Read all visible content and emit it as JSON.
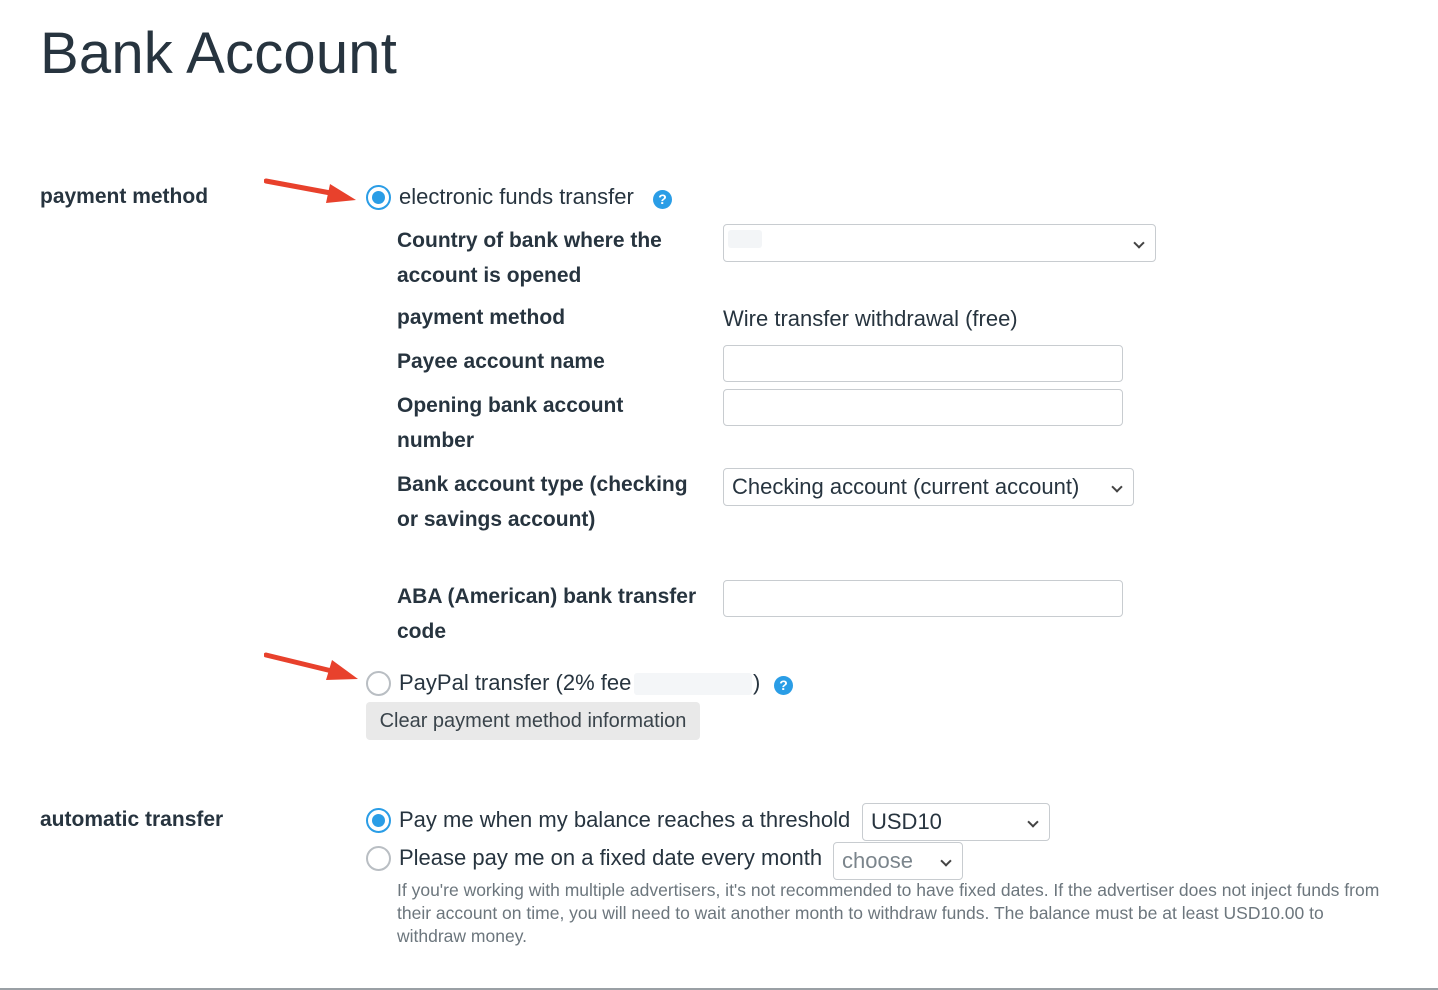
{
  "page": {
    "title": "Bank Account"
  },
  "payment_section": {
    "label": "payment method",
    "eft": {
      "label": "electronic funds transfer",
      "selected": true,
      "help_icon": "question-circle-icon",
      "fields": {
        "country": {
          "label": "Country of bank where the account is opened",
          "value": ""
        },
        "method": {
          "label": "payment method",
          "value": "Wire transfer withdrawal (free)"
        },
        "payee_name": {
          "label": "Payee account name",
          "value": ""
        },
        "account_number": {
          "label": "Opening bank account number",
          "value": ""
        },
        "account_type": {
          "label": "Bank account type (checking or savings account)",
          "value": "Checking account (current account)"
        },
        "aba_code": {
          "label": "ABA (American) bank transfer code",
          "value": ""
        }
      }
    },
    "paypal": {
      "label": "PayPal transfer (2% fee",
      "suffix": ")",
      "selected": false,
      "help_icon": "question-circle-icon"
    },
    "clear_button": "Clear payment method information"
  },
  "auto_transfer": {
    "label": "automatic transfer",
    "threshold_option": {
      "label": "Pay me when my balance reaches a threshold",
      "selected": true,
      "value": "USD10"
    },
    "fixed_date_option": {
      "label": "Please pay me on a fixed date every month",
      "selected": false,
      "value": "choose"
    },
    "note": "If you're working with multiple advertisers, it's not recommended to have fixed dates. If the advertiser does not inject funds from their account on time, you will need to wait another month to withdraw funds. The balance must be at least USD10.00 to withdraw money."
  },
  "colors": {
    "accent": "#2a9de6",
    "annotation_arrow": "#e8412c",
    "text": "#27343f"
  }
}
